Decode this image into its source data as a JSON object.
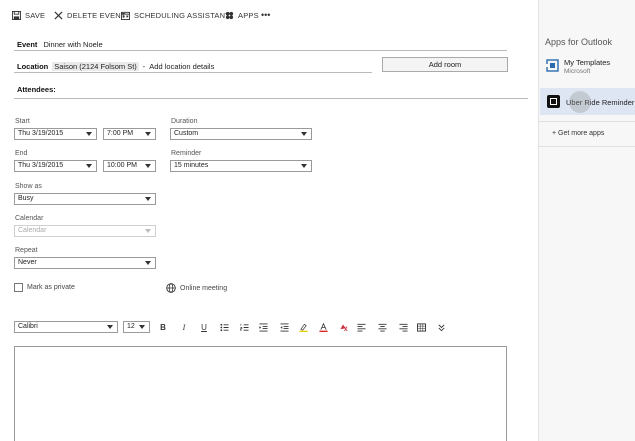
{
  "toolbar": {
    "save": "SAVE",
    "delete_event": "DELETE EVENT",
    "scheduling_assistant": "SCHEDULING ASSISTANT",
    "apps": "APPS",
    "more": "•••"
  },
  "event": {
    "label": "Event",
    "value": "Dinner with Noele"
  },
  "location": {
    "label": "Location",
    "chip": "Saison (2124 Folsom St)",
    "separator": "-",
    "placeholder": "Add location details",
    "add_room": "Add room"
  },
  "attendees": {
    "label": "Attendees:"
  },
  "start": {
    "label": "Start",
    "date": "Thu 3/19/2015",
    "time": "7:00 PM"
  },
  "end": {
    "label": "End",
    "date": "Thu 3/19/2015",
    "time": "10:00 PM"
  },
  "duration": {
    "label": "Duration",
    "value": "Custom"
  },
  "reminder": {
    "label": "Reminder",
    "value": "15 minutes"
  },
  "show_as": {
    "label": "Show as",
    "value": "Busy"
  },
  "calendar": {
    "label": "Calendar",
    "value": "Calendar"
  },
  "repeat": {
    "label": "Repeat",
    "value": "Never"
  },
  "mark_private": "Mark as private",
  "online_meeting": "Online meeting",
  "format": {
    "font": "Calibri",
    "size": "12"
  },
  "sidebar": {
    "title": "Apps for Outlook",
    "apps": [
      {
        "name": "My Templates",
        "vendor": "Microsoft"
      },
      {
        "name": "Uber Ride Reminder",
        "vendor": ""
      }
    ],
    "get_more": "+ Get more apps"
  }
}
